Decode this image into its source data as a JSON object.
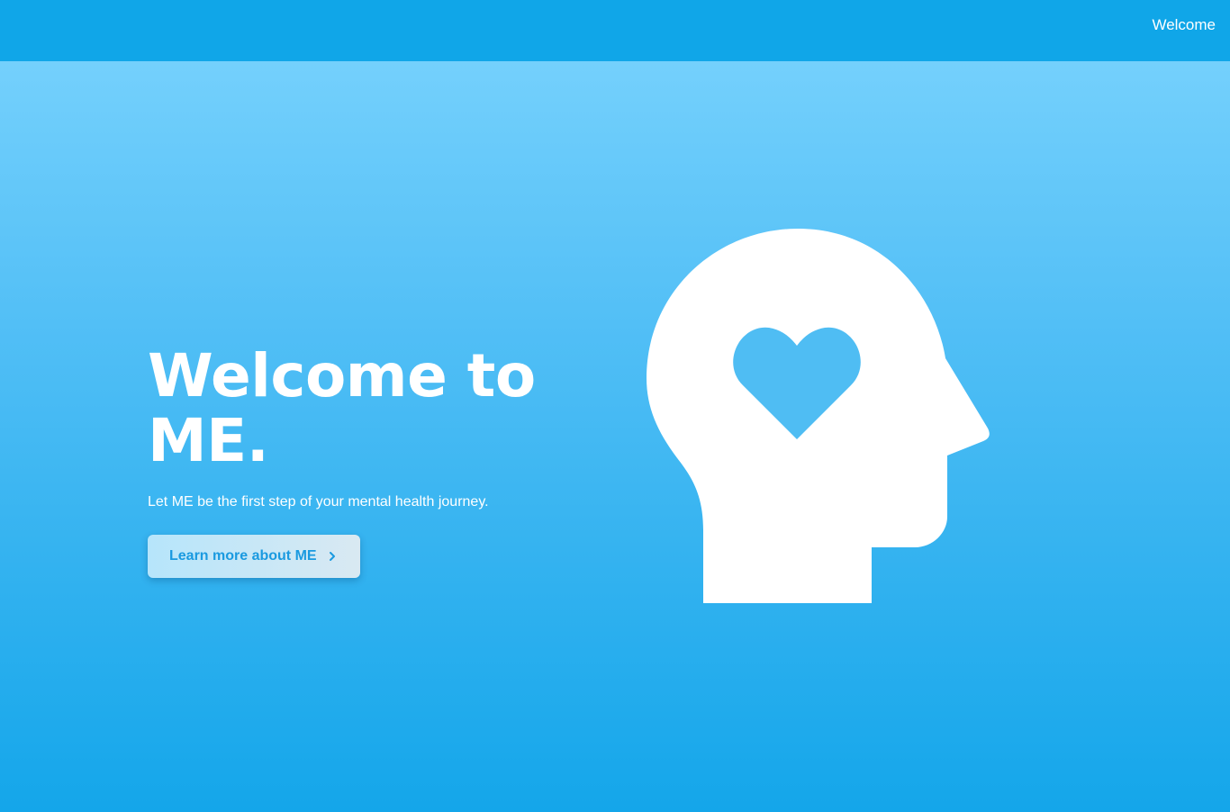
{
  "nav": {
    "welcome_link": "Welcome"
  },
  "hero": {
    "title": "Welcome to ME.",
    "subtitle": "Let ME be the first step of your mental health journey.",
    "cta_label": "Learn more about ME",
    "cta_icon": "chevron-right-icon",
    "illustration": "head-with-heart-icon"
  },
  "colors": {
    "topbar": "#10a6e8",
    "hero_gradient_top": "#74d0fc",
    "hero_gradient_bottom": "#14a6ea",
    "cta_text": "#1a9ae0",
    "heart": "#4fbdf3"
  }
}
